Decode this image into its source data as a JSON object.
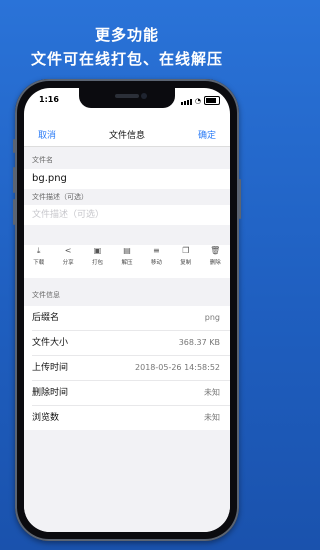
{
  "promo": {
    "line1": "更多功能",
    "line2": "文件可在线打包、在线解压"
  },
  "status_bar": {
    "time": "1:16"
  },
  "nav": {
    "cancel": "取消",
    "title": "文件信息",
    "confirm": "确定"
  },
  "file_name": {
    "label": "文件名",
    "value": "bg.png"
  },
  "description": {
    "label": "文件描述（可选）",
    "placeholder": "文件描述（可选）"
  },
  "toolbar": [
    {
      "icon": "download-icon",
      "label": "下载"
    },
    {
      "icon": "share-icon",
      "label": "分享"
    },
    {
      "icon": "pack-icon",
      "label": "打包"
    },
    {
      "icon": "unpack-icon",
      "label": "解压"
    },
    {
      "icon": "move-icon",
      "label": "移动"
    },
    {
      "icon": "copy-icon",
      "label": "复制"
    },
    {
      "icon": "trash-icon",
      "label": "删除"
    }
  ],
  "info": {
    "header": "文件信息",
    "rows": [
      {
        "label": "后缀名",
        "value": "png"
      },
      {
        "label": "文件大小",
        "value": "368.37 KB"
      },
      {
        "label": "上传时间",
        "value": "2018-05-26 14:58:52"
      },
      {
        "label": "删除时间",
        "value": "未知"
      },
      {
        "label": "浏览数",
        "value": "未知"
      }
    ]
  }
}
